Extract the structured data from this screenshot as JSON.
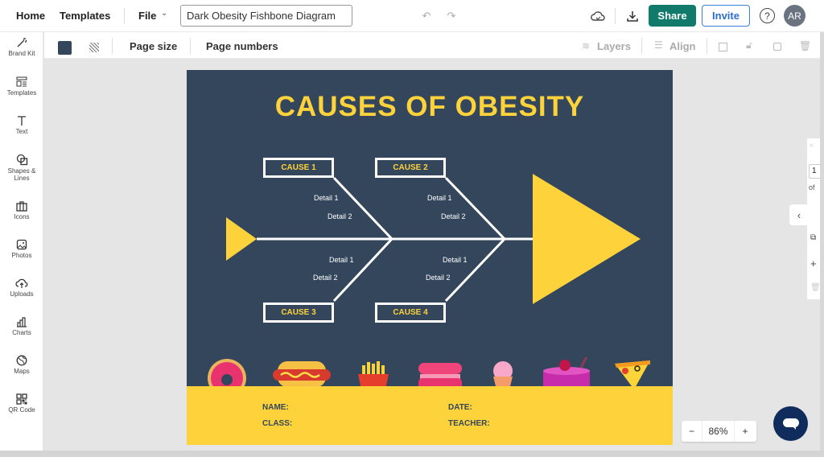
{
  "topbar": {
    "home": "Home",
    "templates": "Templates",
    "file": "File",
    "document_title": "Dark Obesity Fishbone Diagram",
    "share": "Share",
    "invite": "Invite",
    "avatar_initials": "AR"
  },
  "sidebar": {
    "items": [
      {
        "label": "Brand Kit",
        "icon": "magic-wand-icon"
      },
      {
        "label": "Templates",
        "icon": "templates-icon"
      },
      {
        "label": "Text",
        "icon": "text-icon"
      },
      {
        "label": "Shapes &",
        "label2": "Lines",
        "icon": "shapes-icon"
      },
      {
        "label": "Icons",
        "icon": "briefcase-icon"
      },
      {
        "label": "Photos",
        "icon": "photo-icon"
      },
      {
        "label": "Uploads",
        "icon": "upload-cloud-icon"
      },
      {
        "label": "Charts",
        "icon": "bar-chart-icon"
      },
      {
        "label": "Maps",
        "icon": "globe-icon"
      },
      {
        "label": "QR Code",
        "icon": "qr-code-icon"
      }
    ]
  },
  "toolbar": {
    "page_size": "Page size",
    "page_numbers": "Page numbers",
    "layers": "Layers",
    "align": "Align",
    "background_color": "#34465c"
  },
  "diagram": {
    "title": "CAUSES OF OBESITY",
    "causes": [
      "CAUSE 1",
      "CAUSE 2",
      "CAUSE 3",
      "CAUSE 4"
    ],
    "detail1": "Detail 1",
    "detail2": "Detail 2",
    "footer": {
      "name": "NAME:",
      "class": "CLASS:",
      "date": "DATE:",
      "teacher": "TEACHER:"
    },
    "colors": {
      "background": "#34465c",
      "accent": "#fdd23a",
      "line": "#ffffff"
    }
  },
  "right_panel": {
    "page": "1",
    "of": "of"
  },
  "zoom": {
    "minus": "−",
    "value": "86%",
    "plus": "+"
  }
}
